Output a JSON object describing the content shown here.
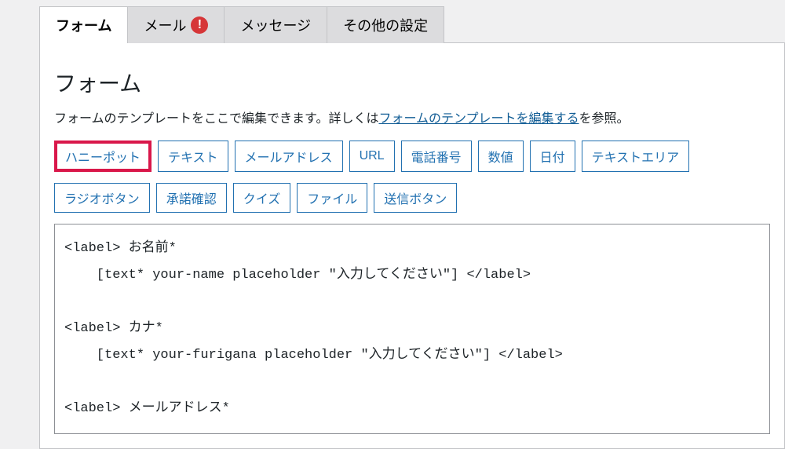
{
  "tabs": [
    {
      "label": "フォーム",
      "active": true
    },
    {
      "label": "メール",
      "alert": true
    },
    {
      "label": "メッセージ"
    },
    {
      "label": "その他の設定"
    }
  ],
  "section": {
    "title": "フォーム",
    "desc_prefix": "フォームのテンプレートをここで編集できます。詳しくは",
    "desc_link": "フォームのテンプレートを編集する",
    "desc_suffix": "を参照。"
  },
  "tag_buttons_row1": [
    {
      "label": "ハニーポット",
      "highlighted": true
    },
    {
      "label": "テキスト"
    },
    {
      "label": "メールアドレス"
    },
    {
      "label": "URL"
    },
    {
      "label": "電話番号"
    },
    {
      "label": "数値"
    },
    {
      "label": "日付"
    },
    {
      "label": "テキストエリア"
    }
  ],
  "tag_buttons_row2": [
    {
      "label": "ラジオボタン"
    },
    {
      "label": "承諾確認"
    },
    {
      "label": "クイズ"
    },
    {
      "label": "ファイル"
    },
    {
      "label": "送信ボタン"
    }
  ],
  "code_content": "<label> お名前*\n    [text* your-name placeholder \"入力してください\"] </label>\n\n<label> カナ*\n    [text* your-furigana placeholder \"入力してください\"] </label>\n\n<label> メールアドレス*"
}
